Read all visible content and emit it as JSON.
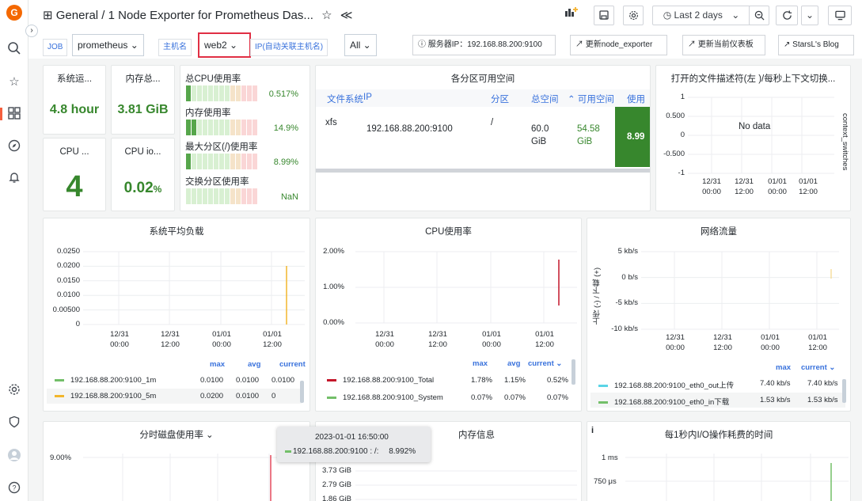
{
  "sidebar": {
    "logo": "G"
  },
  "header": {
    "grid_icon": "⊞",
    "title": "General / 1 Node Exporter for Prometheus Das...",
    "star": "☆",
    "share": "≪",
    "time_range": "Last 2 days",
    "collapse": "⌄"
  },
  "vars": {
    "job_label": "JOB",
    "job_value": "prometheus ⌄",
    "host_label": "主机名",
    "host_value": "web2 ⌄",
    "ip_label": "IP(自动关联主机名)",
    "ip_value": "All ⌄",
    "server_ip": "ⓘ 服务器IP：192.168.88.200:9100",
    "link1": "↗ 更新node_exporter",
    "link2": "↗ 更新当前仪表板",
    "link3": "↗ StarsL's Blog"
  },
  "stats": {
    "uptime_title": "系统运...",
    "uptime": "4.8 hour",
    "mem_title": "内存总...",
    "mem": "3.81 GiB",
    "cpu_title": "CPU ...",
    "cpu": "4",
    "iowait_title": "CPU io...",
    "iowait": "0.02",
    "iowait_unit": "%"
  },
  "gauges": [
    {
      "title": "总CPU使用率",
      "value": "0.517%",
      "fraction": 0.005
    },
    {
      "title": "内存使用率",
      "value": "14.9%",
      "fraction": 0.149
    },
    {
      "title": "最大分区(/)使用率",
      "value": "8.99%",
      "fraction": 0.0899
    },
    {
      "title": "交换分区使用率",
      "value": "NaN",
      "fraction": 0
    }
  ],
  "disk_table": {
    "title": "各分区可用空间",
    "headers": [
      "文件系统",
      "IP",
      "分区",
      "总空间",
      "可用空间",
      "使用"
    ],
    "row": {
      "fs": "xfs",
      "ip": "192.168.88.200:9100",
      "mount": "/",
      "total1": "60.0",
      "total2": "GiB",
      "avail1": "54.58",
      "avail2": "GiB",
      "used": "8.99"
    }
  },
  "fd_panel": {
    "title": "打开的文件描述符(左 )/每秒上下文切换...",
    "no_data": "No data",
    "right_label": "context_switches",
    "yticks": [
      "1",
      "0.500",
      "0",
      "-0.500",
      "-1"
    ],
    "xticks": [
      [
        "12/31",
        "00:00"
      ],
      [
        "12/31",
        "12:00"
      ],
      [
        "01/01",
        "00:00"
      ],
      [
        "01/01",
        "12:00"
      ]
    ]
  },
  "load_panel": {
    "title": "系统平均负载",
    "yticks": [
      "0.0250",
      "0.0200",
      "0.0150",
      "0.0100",
      "0.00500",
      "0"
    ],
    "xticks": [
      [
        "12/31",
        "00:00"
      ],
      [
        "12/31",
        "12:00"
      ],
      [
        "01/01",
        "00:00"
      ],
      [
        "01/01",
        "12:00"
      ]
    ],
    "headers": [
      "max",
      "avg",
      "current"
    ],
    "series": [
      {
        "name": "192.168.88.200:9100_1m",
        "max": "0.0100",
        "avg": "0.0100",
        "current": "0.0100",
        "color": "#73bf69"
      },
      {
        "name": "192.168.88.200:9100_5m",
        "max": "0.0200",
        "avg": "0.0100",
        "current": "0",
        "color": "#f2b62c"
      }
    ]
  },
  "cpu_panel": {
    "title": "CPU使用率",
    "yticks": [
      "2.00%",
      "1.00%",
      "0.00%"
    ],
    "xticks": [
      [
        "12/31",
        "00:00"
      ],
      [
        "12/31",
        "12:00"
      ],
      [
        "01/01",
        "00:00"
      ],
      [
        "01/01",
        "12:00"
      ]
    ],
    "headers": [
      "max",
      "avg",
      "current ⌄"
    ],
    "series": [
      {
        "name": "192.168.88.200:9100_Total",
        "max": "1.78%",
        "avg": "1.15%",
        "current": "0.52%",
        "color": "#c4162a"
      },
      {
        "name": "192.168.88.200:9100_System",
        "max": "0.07%",
        "avg": "0.07%",
        "current": "0.07%",
        "color": "#73bf69"
      }
    ]
  },
  "net_panel": {
    "title": "网络流量",
    "yticks": [
      "5 kb/s",
      "0 b/s",
      "-5 kb/s",
      "-10 kb/s"
    ],
    "ylabel": "上传 (-) / 下载 (+)",
    "xticks": [
      [
        "12/31",
        "00:00"
      ],
      [
        "12/31",
        "12:00"
      ],
      [
        "01/01",
        "00:00"
      ],
      [
        "01/01",
        "12:00"
      ]
    ],
    "headers": [
      "max",
      "current ⌄"
    ],
    "series": [
      {
        "name": "192.168.88.200:9100_eth0_out上传",
        "max": "7.40 kb/s",
        "current": "7.40 kb/s",
        "color": "#5ad4e6"
      },
      {
        "name": "192.168.88.200:9100_eth0_in下载",
        "max": "1.53 kb/s",
        "current": "1.53 kb/s",
        "color": "#73bf69"
      }
    ]
  },
  "bottom": {
    "disk_usage_title": "分时磁盘使用率 ⌄",
    "disk_usage_ytick": "9.00%",
    "mem_title": "内存信息",
    "mem_yticks": [
      "3.73 GiB",
      "2.79 GiB",
      "1.86 GiB"
    ],
    "io_title": "每1秒内I/O操作耗费的时间",
    "io_info": "i",
    "io_yticks": [
      "1 ms",
      "750 μs"
    ]
  },
  "tooltip": {
    "time": "2023-01-01 16:50:00",
    "series": "192.168.88.200:9100 : /:",
    "value": "8.992%"
  },
  "colors": {
    "green": "#37872d",
    "accent": "#3871dc",
    "highlight": "#e02f44"
  }
}
